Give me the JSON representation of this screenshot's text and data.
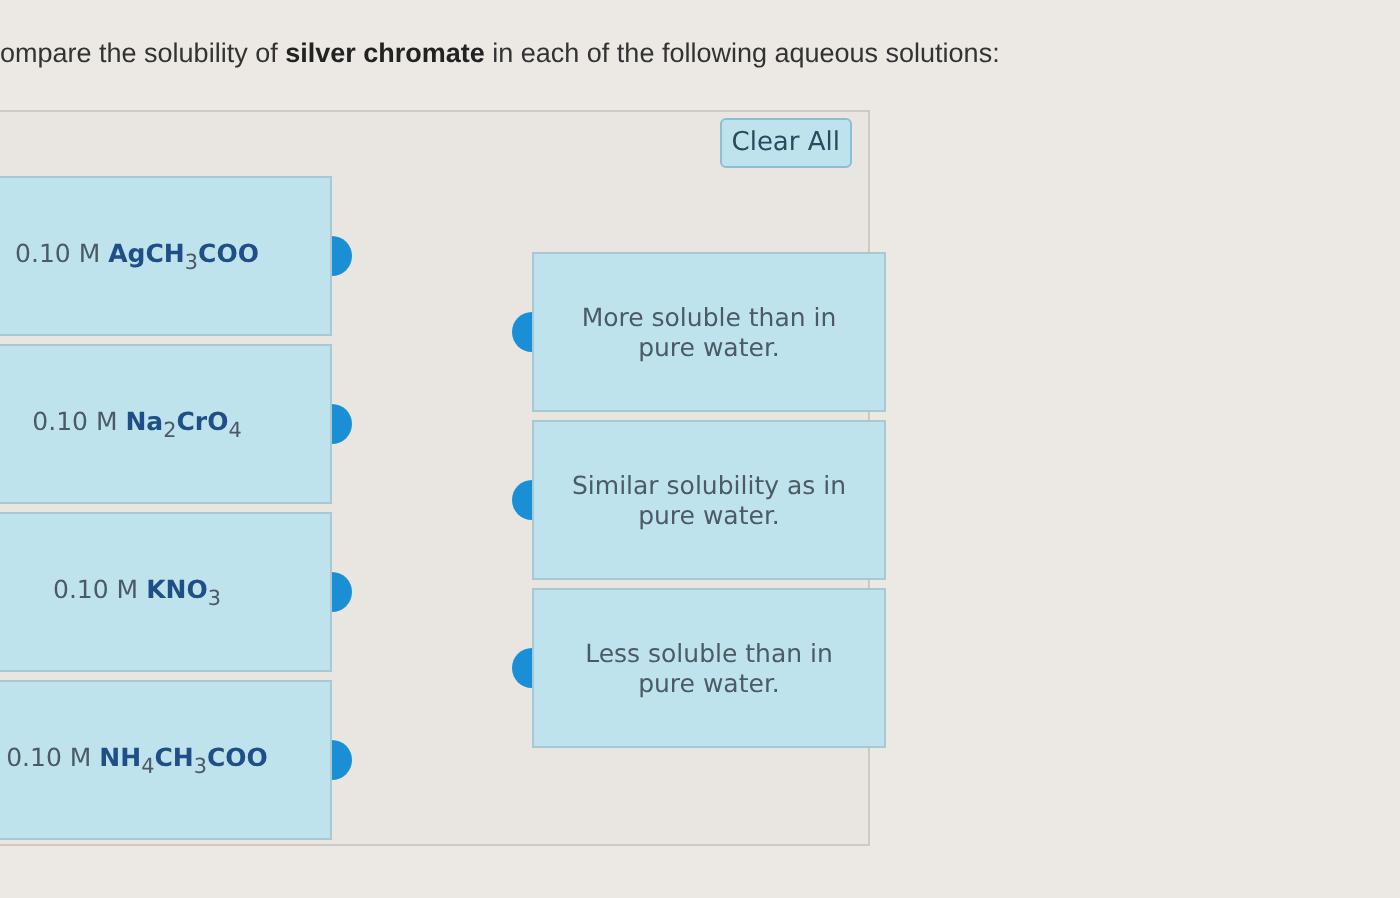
{
  "prompt": "ompare the solubility of **silver chromate** in each of the following aqueous solutions:",
  "clear_button": "Clear All",
  "solutions": [
    {
      "label": "0.10 M **AgCH**$_{3}$**COO**"
    },
    {
      "label": "0.10 M **Na**$_{2}$**CrO**$_{4}$"
    },
    {
      "label": "0.10 M **KNO**$_{3}$"
    },
    {
      "label": "0.10 M **NH**$_{4}$**CH**$_{3}$**COO**"
    }
  ],
  "answers": [
    {
      "label": "More soluble than in pure water."
    },
    {
      "label": "Similar solubility as in pure water."
    },
    {
      "label": "Less soluble than in pure water."
    }
  ]
}
